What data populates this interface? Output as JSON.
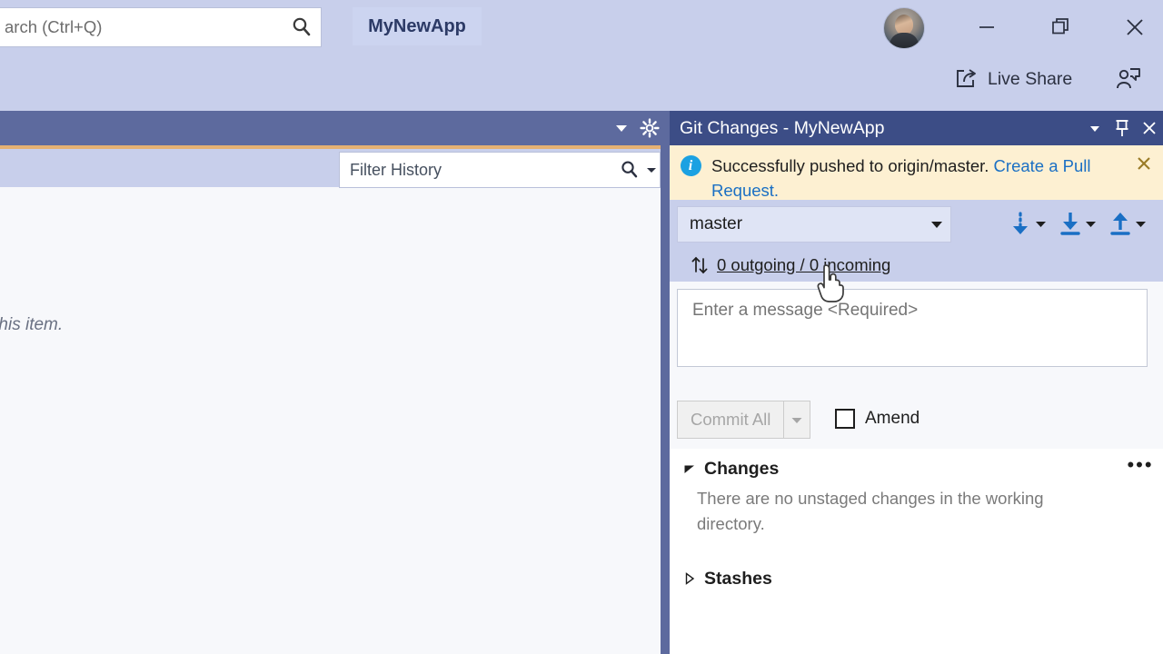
{
  "shell": {
    "search": {
      "value": "arch (Ctrl+Q)",
      "icon": "search-icon"
    },
    "app_title": "MyNewApp",
    "window_controls": {
      "minimize": "minimize-icon",
      "restore": "restore-icon",
      "close": "close-icon"
    },
    "live_share": {
      "label": "Live Share",
      "icon": "share-icon"
    },
    "feedback_icon": "feedback-person-icon",
    "avatar": "user-avatar",
    "background_color": "#c8cfeb"
  },
  "left_panel": {
    "toolbar": {
      "caret_icon": "chevron-down-icon",
      "gear_icon": "gear-icon",
      "background_color": "#5d6a9e",
      "accent_color": "#e5b173"
    },
    "filter": {
      "value": "Filter History",
      "search_icon": "search-icon",
      "caret_icon": "chevron-down-icon"
    },
    "empty_text": "ory for this item."
  },
  "git_changes": {
    "header": {
      "title": "Git Changes - MyNewApp",
      "dropdown_icon": "chevron-down-icon",
      "pin_icon": "pin-icon",
      "close_icon": "close-icon",
      "background_color": "#3c4d86"
    },
    "notification": {
      "icon": "info-icon",
      "info_glyph": "i",
      "message": "Successfully pushed to origin/master.",
      "link_text": "Create a Pull Request.",
      "close_icon": "close-icon",
      "background_color": "#fdf0d2",
      "link_color": "#1a6fc4"
    },
    "branch": {
      "name": "master",
      "caret_icon": "chevron-down-icon",
      "fetch_icon": "fetch-icon",
      "pull_icon": "pull-icon",
      "push_icon": "push-icon",
      "op_caret_icon": "chevron-down-icon",
      "accent_color": "#1a6fc4"
    },
    "sync": {
      "icon": "sync-arrows-icon",
      "label": "0 outgoing / 0 incoming"
    },
    "commit": {
      "message_placeholder": "Enter a message <Required>",
      "message_value": "",
      "commit_button_label": "Commit All",
      "commit_button_enabled": false,
      "commit_split_icon": "chevron-down-icon",
      "amend_label": "Amend",
      "amend_checked": false
    },
    "changes_section": {
      "title": "Changes",
      "expanded": true,
      "triangle_icon": "triangle-down-icon",
      "more_icon": "ellipsis-icon",
      "more_label": "•••",
      "empty_message": "There are no unstaged changes in the working directory."
    },
    "stashes_section": {
      "title": "Stashes",
      "expanded": false,
      "triangle_icon": "triangle-right-icon"
    }
  },
  "cursor": {
    "type": "pointing-hand-cursor"
  }
}
